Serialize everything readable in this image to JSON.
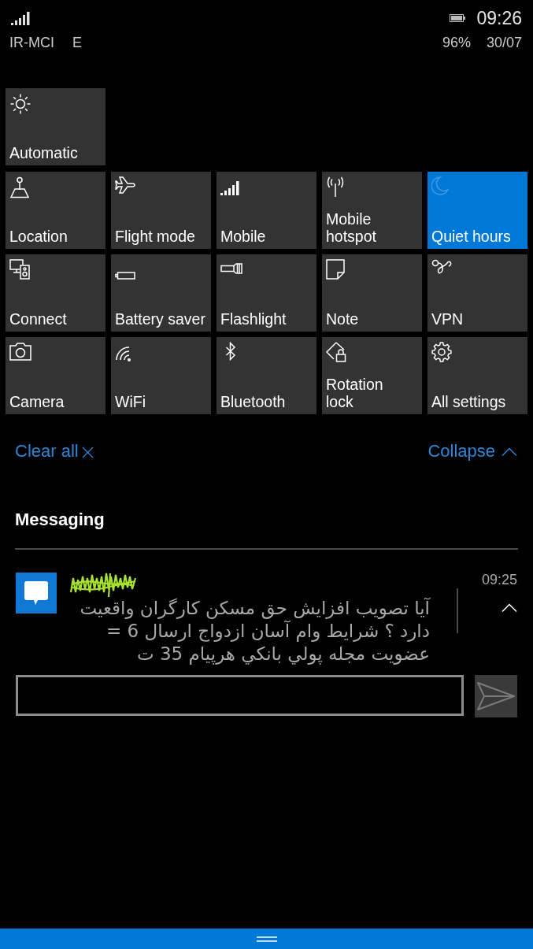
{
  "status_bar": {
    "carrier": "IR-MCI",
    "network": "E",
    "battery": "96%",
    "time": "09:26",
    "date": "30/07"
  },
  "brightness_tile": {
    "label": "Automatic"
  },
  "quick_actions": [
    {
      "label": "Location",
      "on": false
    },
    {
      "label": "Flight mode",
      "on": false
    },
    {
      "label": "Mobile",
      "on": false
    },
    {
      "label": "Mobile\nhotspot",
      "on": false
    },
    {
      "label": "Quiet hours",
      "on": true
    },
    {
      "label": "Connect",
      "on": false
    },
    {
      "label": "Battery saver",
      "on": false
    },
    {
      "label": "Flashlight",
      "on": false
    },
    {
      "label": "Note",
      "on": false
    },
    {
      "label": "VPN",
      "on": false
    },
    {
      "label": "Camera",
      "on": false
    },
    {
      "label": "WiFi",
      "on": false
    },
    {
      "label": "Bluetooth",
      "on": false
    },
    {
      "label": "Rotation\nlock",
      "on": false
    },
    {
      "label": "All settings",
      "on": false
    }
  ],
  "actions": {
    "clear_all": "Clear all",
    "collapse": "Collapse"
  },
  "notification_group": {
    "app": "Messaging",
    "notifications": [
      {
        "time": "09:25",
        "body": "آیا تصویب افزایش حق مسکن کارگران واقعیت دارد ؟ شرایط وام آسان ازدواج ارسال 6 = عضویت مجله پولي بانكي هرپيام 35 ت",
        "expanded": true,
        "send_button": {
          "disabled": true
        }
      }
    ]
  }
}
